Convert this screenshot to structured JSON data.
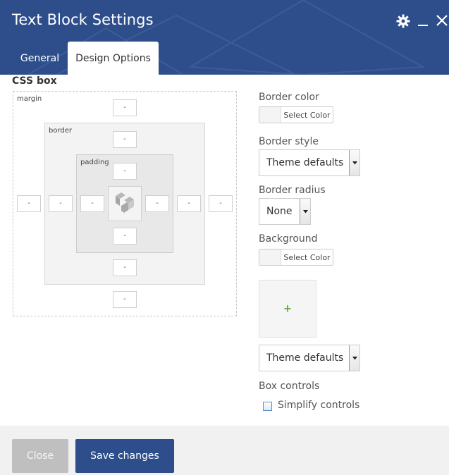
{
  "header": {
    "title": "Text Block Settings",
    "bg_color": "#2d4e8a",
    "icons": [
      "gear-icon",
      "minimize-icon",
      "close-icon"
    ]
  },
  "tabs": [
    {
      "label": "General",
      "active": false
    },
    {
      "label": "Design Options",
      "active": true
    }
  ],
  "css_box": {
    "title": "CSS box",
    "labels": {
      "margin": "margin",
      "border": "border",
      "padding": "padding"
    },
    "inputs": {
      "margin_top": "-",
      "margin_right": "-",
      "margin_bottom": "-",
      "margin_left": "-",
      "border_top": "-",
      "border_right": "-",
      "border_bottom": "-",
      "border_left": "-",
      "padding_top": "-",
      "padding_right": "-",
      "padding_bottom": "-",
      "padding_left": "-"
    },
    "content_icon": "logo-cube-icon"
  },
  "options": {
    "border_color": {
      "label": "Border color",
      "button": "Select Color"
    },
    "border_style": {
      "label": "Border style",
      "value": "Theme defaults"
    },
    "border_radius": {
      "label": "Border radius",
      "value": "None"
    },
    "background": {
      "label": "Background",
      "button": "Select Color"
    },
    "image_add": {
      "symbol": "+"
    },
    "background_style": {
      "value": "Theme defaults"
    },
    "box_controls": {
      "label": "Box controls",
      "checkbox_label": "Simplify controls",
      "checked": false
    }
  },
  "footer": {
    "close_label": "Close",
    "save_label": "Save changes"
  }
}
